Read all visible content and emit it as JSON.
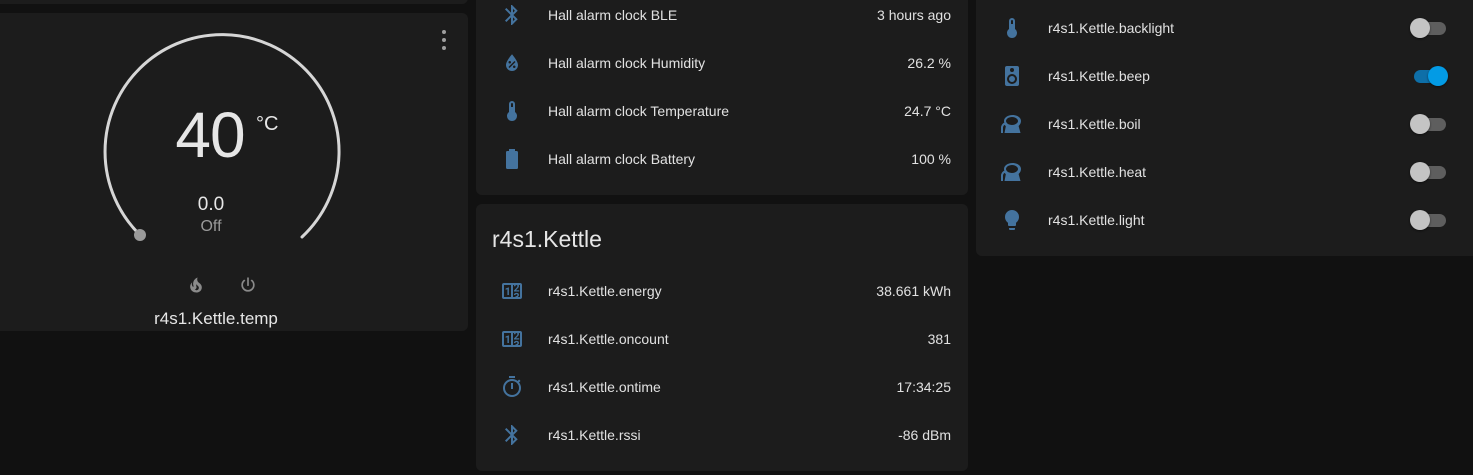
{
  "colors": {
    "background": "#111111",
    "card": "#1c1c1c",
    "icon": "#44739e",
    "accent": "#039be5",
    "dial": "#d6d6d6"
  },
  "thermostat": {
    "target": "40",
    "unit": "°C",
    "current": "0.0",
    "mode": "Off",
    "name": "r4s1.Kettle.temp",
    "mode_icons": [
      "fire-icon",
      "power-icon"
    ]
  },
  "sensors": {
    "rows": [
      {
        "icon": "bluetooth-icon",
        "label": "Hall alarm clock BLE",
        "value": "3 hours ago"
      },
      {
        "icon": "water-percent-icon",
        "label": "Hall alarm clock Humidity",
        "value": "26.2 %"
      },
      {
        "icon": "thermometer-icon",
        "label": "Hall alarm clock Temperature",
        "value": "24.7 °C"
      },
      {
        "icon": "battery-icon",
        "label": "Hall alarm clock Battery",
        "value": "100 %"
      }
    ]
  },
  "kettle": {
    "title": "r4s1.Kettle",
    "rows": [
      {
        "icon": "counter-icon",
        "label": "r4s1.Kettle.energy",
        "value": "38.661 kWh"
      },
      {
        "icon": "counter-icon",
        "label": "r4s1.Kettle.oncount",
        "value": "381"
      },
      {
        "icon": "timer-icon",
        "label": "r4s1.Kettle.ontime",
        "value": "17:34:25"
      },
      {
        "icon": "bluetooth-icon",
        "label": "r4s1.Kettle.rssi",
        "value": "-86 dBm"
      }
    ]
  },
  "switches": {
    "rows": [
      {
        "icon": "thermometer-icon",
        "label": "r4s1.Kettle.backlight",
        "on": false
      },
      {
        "icon": "speaker-icon",
        "label": "r4s1.Kettle.beep",
        "on": true
      },
      {
        "icon": "kettle-icon",
        "label": "r4s1.Kettle.boil",
        "on": false
      },
      {
        "icon": "kettle-icon",
        "label": "r4s1.Kettle.heat",
        "on": false
      },
      {
        "icon": "lightbulb-icon",
        "label": "r4s1.Kettle.light",
        "on": false
      }
    ]
  }
}
